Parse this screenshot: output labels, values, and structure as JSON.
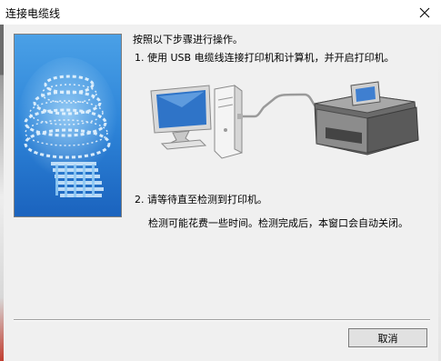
{
  "window": {
    "title": "连接电缆线",
    "close_icon": "close-icon"
  },
  "content": {
    "instruction": "按照以下步骤进行操作。",
    "step1": "1. 使用 USB 电缆线连接打印机和计算机，并开启打印机。",
    "step2": "2. 请等待直至检测到打印机。",
    "step2_detail": "检测可能花费一些时间。检测完成后，本窗口会自动关闭。"
  },
  "illustration": {
    "icons": [
      "desktop-computer-icon",
      "usb-cable-icon",
      "printer-icon"
    ]
  },
  "buttons": {
    "cancel": "取消"
  }
}
